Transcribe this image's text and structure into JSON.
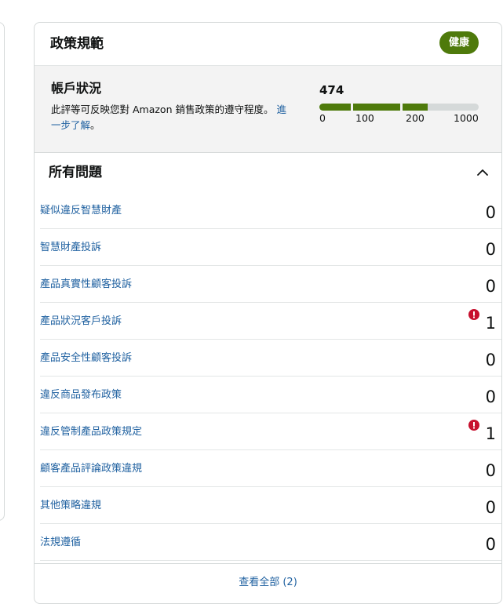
{
  "card": {
    "title": "政策規範",
    "status_badge": "健康"
  },
  "account_health": {
    "title": "帳戶狀況",
    "description": "此評等可反映您對 Amazon 銷售政策的遵守程度。",
    "learn_more": "進一步了解",
    "description_suffix": "。",
    "score": "474",
    "scale_labels": [
      "0",
      "100",
      "200",
      "1000"
    ],
    "score_color": "#4e7a0b"
  },
  "issues": {
    "title": "所有問題",
    "items": [
      {
        "label": "疑似違反智慧財產",
        "count": "0",
        "alert": false
      },
      {
        "label": "智慧財產投訴",
        "count": "0",
        "alert": false
      },
      {
        "label": "產品真實性顧客投訴",
        "count": "0",
        "alert": false
      },
      {
        "label": "產品狀況客戶投訴",
        "count": "1",
        "alert": true
      },
      {
        "label": "產品安全性顧客投訴",
        "count": "0",
        "alert": false
      },
      {
        "label": "違反商品發布政策",
        "count": "0",
        "alert": false
      },
      {
        "label": "違反管制產品政策規定",
        "count": "1",
        "alert": true
      },
      {
        "label": "顧客產品評論政策違規",
        "count": "0",
        "alert": false
      },
      {
        "label": "其他策略違規",
        "count": "0",
        "alert": false
      },
      {
        "label": "法規遵循",
        "count": "0",
        "alert": false
      }
    ],
    "alert_color": "#c7102e"
  },
  "footer": {
    "view_all": "查看全部 (2)"
  }
}
